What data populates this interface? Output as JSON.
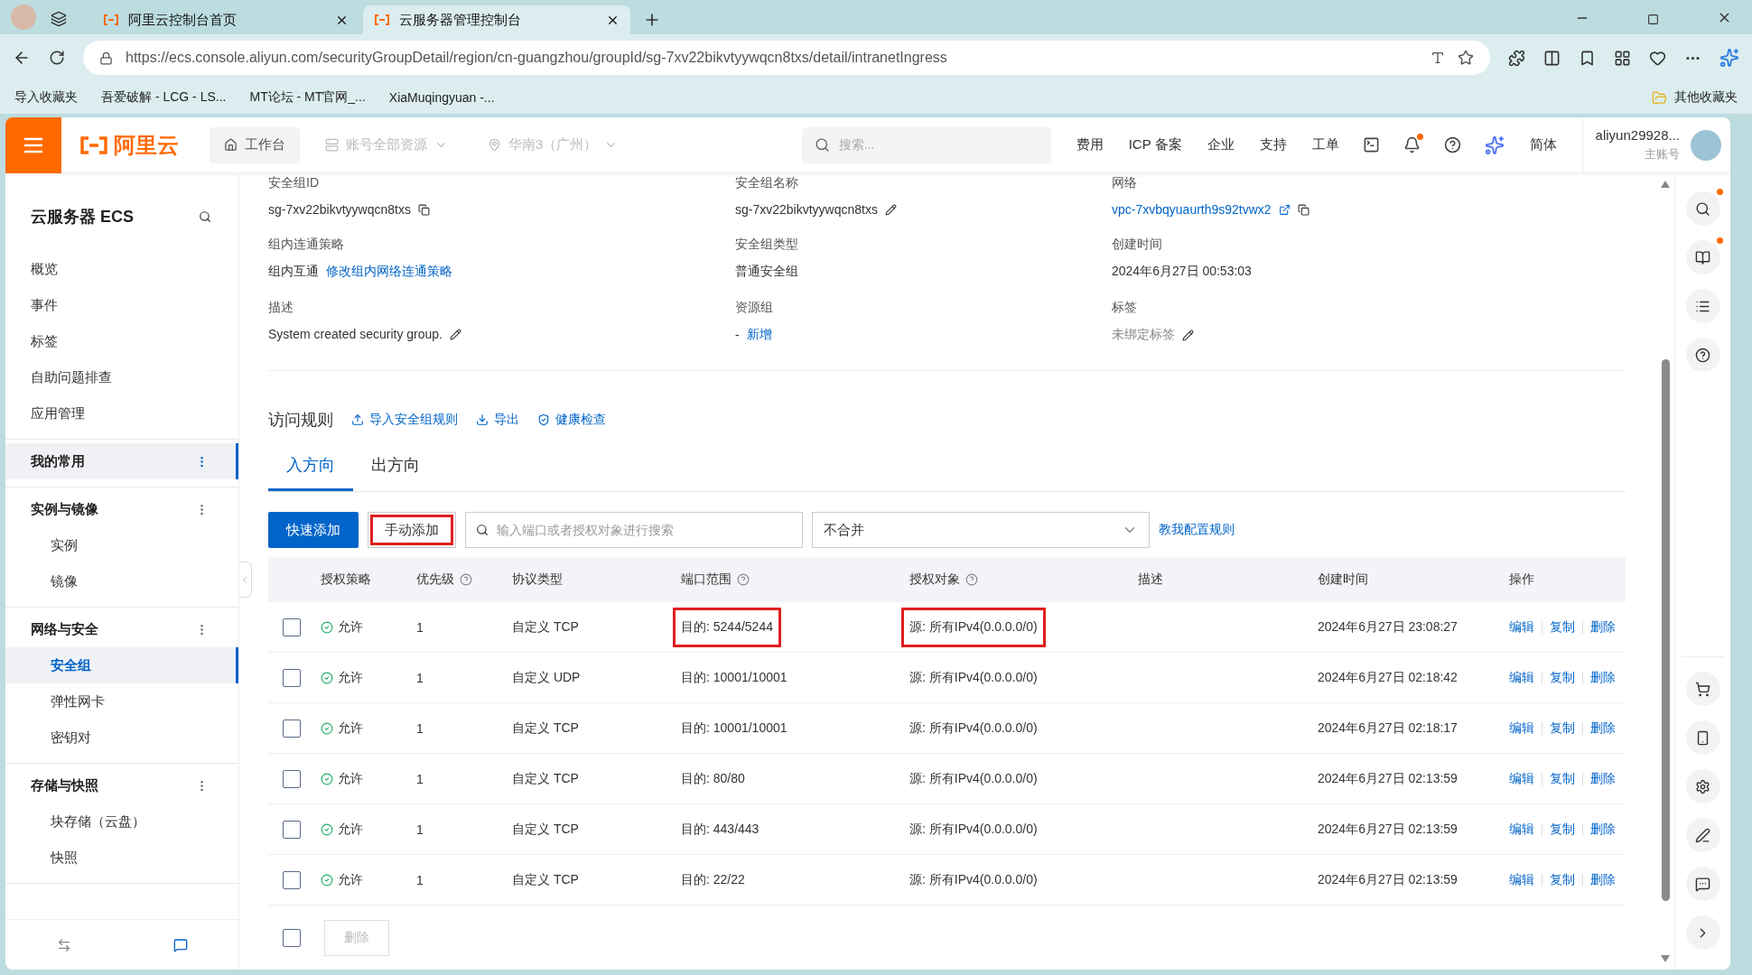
{
  "browser": {
    "tabs": [
      {
        "title": "阿里云控制台首页",
        "selected": false
      },
      {
        "title": "云服务器管理控制台",
        "selected": true
      }
    ],
    "url": "https://ecs.console.aliyun.com/securityGroupDetail/region/cn-guangzhou/groupId/sg-7xv22bikvtyywqcn8txs/detail/intranetIngress",
    "bookmarks": [
      "导入收藏夹",
      "吾爱破解 - LCG - LS...",
      "MT论坛 - MT官网_...",
      "XiaMuqingyuan -..."
    ],
    "other_bookmarks": "其他收藏夹"
  },
  "header": {
    "logo": "阿里云",
    "workbench": "工作台",
    "resources": "账号全部资源",
    "region": "华南3（广州）",
    "search_placeholder": "搜索...",
    "links": [
      "费用",
      "ICP 备案",
      "企业",
      "支持",
      "工单"
    ],
    "bell_badge": true,
    "language": "简体",
    "user": "aliyun29928...",
    "account_type": "主账号"
  },
  "sidebar": {
    "title": "云服务器 ECS",
    "sections": [
      {
        "items": [
          {
            "label": "概览",
            "selected": false
          },
          {
            "label": "事件",
            "selected": false
          },
          {
            "label": "标签",
            "selected": false
          },
          {
            "label": "自助问题排查",
            "selected": false
          },
          {
            "label": "应用管理",
            "selected": false
          }
        ]
      },
      {
        "title": "我的常用",
        "selected": true
      },
      {
        "title": "实例与镜像",
        "selected": false,
        "items": [
          {
            "label": "实例",
            "selected": false
          },
          {
            "label": "镜像",
            "selected": false
          }
        ]
      },
      {
        "title": "网络与安全",
        "selected": false,
        "items": [
          {
            "label": "安全组",
            "selected": true
          },
          {
            "label": "弹性网卡",
            "selected": false
          },
          {
            "label": "密钥对",
            "selected": false
          }
        ]
      },
      {
        "title": "存储与快照",
        "selected": false,
        "items": [
          {
            "label": "块存储（云盘）",
            "selected": false
          },
          {
            "label": "快照",
            "selected": false
          }
        ]
      }
    ]
  },
  "info": [
    {
      "label": "安全组ID",
      "value": "sg-7xv22bikvtyywqcn8txs",
      "copyable": true
    },
    {
      "label": "安全组名称",
      "value": "sg-7xv22bikvtyywqcn8txs",
      "editable": true
    },
    {
      "label": "网络",
      "link": "vpc-7xvbqyuaurth9s92tvwx2",
      "external": true,
      "copyable": true
    },
    {
      "label": "组内连通策略",
      "value": "组内互通",
      "link": "修改组内网络连通策略"
    },
    {
      "label": "安全组类型",
      "value": "普通安全组"
    },
    {
      "label": "创建时间",
      "value": "2024年6月27日 00:53:03"
    },
    {
      "label": "描述",
      "value": "System created security group.",
      "editable": true
    },
    {
      "label": "资源组",
      "value": "-",
      "link": "新增"
    },
    {
      "label": "标签",
      "muted_value": "未绑定标签",
      "editable": true
    }
  ],
  "rules": {
    "title": "访问规则",
    "actions": [
      "导入安全组规则",
      "导出",
      "健康检查"
    ],
    "tabs": [
      {
        "label": "入方向",
        "selected": true
      },
      {
        "label": "出方向",
        "selected": false
      }
    ],
    "quick_add": "快速添加",
    "manual_add": {
      "label": "手动添加",
      "marked": true
    },
    "search_placeholder": "输入端口或者授权对象进行搜索",
    "merge_select": "不合并",
    "help_link": "教我配置规则",
    "columns": [
      "授权策略",
      "优先级",
      "协议类型",
      "端口范围",
      "授权对象",
      "描述",
      "创建时间",
      "操作"
    ],
    "rows": [
      {
        "checked": false,
        "policy": "允许",
        "priority": "1",
        "protocol": "自定义 TCP",
        "port": "目的: 5244/5244",
        "port_marked": true,
        "source": "源: 所有IPv4(0.0.0.0/0)",
        "source_marked": true,
        "created": "2024年6月27日 23:08:27",
        "ops": [
          "编辑",
          "复制",
          "删除"
        ]
      },
      {
        "checked": false,
        "policy": "允许",
        "priority": "1",
        "protocol": "自定义 UDP",
        "port": "目的: 10001/10001",
        "port_marked": false,
        "source": "源: 所有IPv4(0.0.0.0/0)",
        "source_marked": false,
        "created": "2024年6月27日 02:18:42",
        "ops": [
          "编辑",
          "复制",
          "删除"
        ]
      },
      {
        "checked": false,
        "policy": "允许",
        "priority": "1",
        "protocol": "自定义 TCP",
        "port": "目的: 10001/10001",
        "port_marked": false,
        "source": "源: 所有IPv4(0.0.0.0/0)",
        "source_marked": false,
        "created": "2024年6月27日 02:18:17",
        "ops": [
          "编辑",
          "复制",
          "删除"
        ]
      },
      {
        "checked": false,
        "policy": "允许",
        "priority": "1",
        "protocol": "自定义 TCP",
        "port": "目的: 80/80",
        "port_marked": false,
        "source": "源: 所有IPv4(0.0.0.0/0)",
        "source_marked": false,
        "created": "2024年6月27日 02:13:59",
        "ops": [
          "编辑",
          "复制",
          "删除"
        ]
      },
      {
        "checked": false,
        "policy": "允许",
        "priority": "1",
        "protocol": "自定义 TCP",
        "port": "目的: 443/443",
        "port_marked": false,
        "source": "源: 所有IPv4(0.0.0.0/0)",
        "source_marked": false,
        "created": "2024年6月27日 02:13:59",
        "ops": [
          "编辑",
          "复制",
          "删除"
        ]
      },
      {
        "checked": false,
        "policy": "允许",
        "priority": "1",
        "protocol": "自定义 TCP",
        "port": "目的: 22/22",
        "port_marked": false,
        "source": "源: 所有IPv4(0.0.0.0/0)",
        "source_marked": false,
        "created": "2024年6月27日 02:13:59",
        "ops": [
          "编辑",
          "复制",
          "删除"
        ]
      }
    ],
    "select_all": false,
    "bulk_delete": {
      "label": "删除",
      "disabled": true
    }
  },
  "rail": {
    "top": [
      {
        "badge": true
      },
      {
        "badge": true
      },
      {
        "badge": false
      },
      {
        "badge": false
      }
    ],
    "bottom": [
      {
        "badge": false
      },
      {
        "badge": false
      },
      {
        "badge": false
      },
      {
        "badge": false
      },
      {
        "badge": false
      },
      {
        "badge": false
      }
    ]
  }
}
